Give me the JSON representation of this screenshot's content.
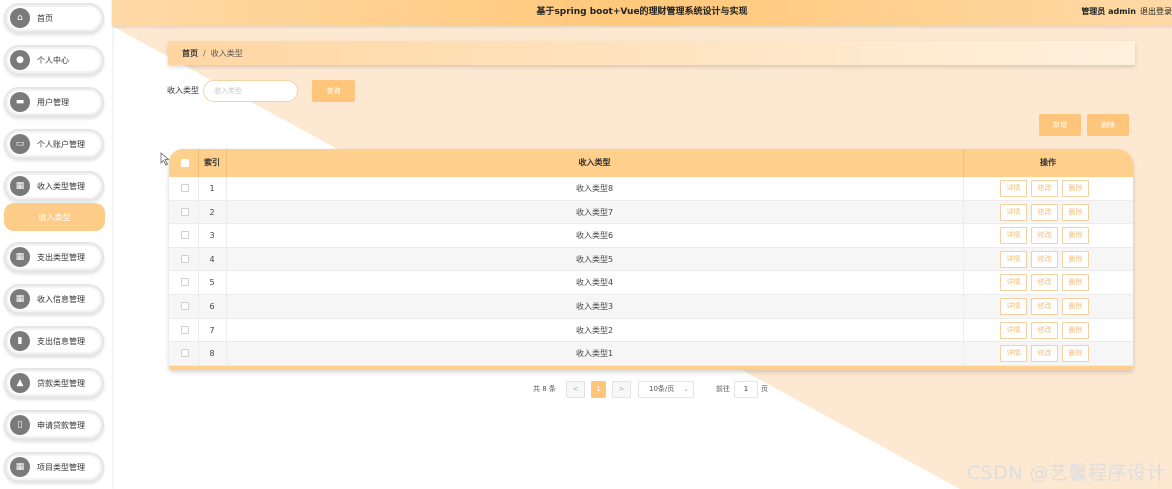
{
  "header": {
    "title": "基于spring boot+Vue的理财管理系统设计与实现",
    "user": "管理员 admin",
    "logout": "退出登录"
  },
  "sidebar": {
    "items": [
      {
        "label": "首页",
        "icon": "home-icon"
      },
      {
        "label": "个人中心",
        "icon": "user-icon"
      },
      {
        "label": "用户管理",
        "icon": "users-icon"
      },
      {
        "label": "个人账户管理",
        "icon": "wallet-icon"
      },
      {
        "label": "收入类型管理",
        "icon": "grid-icon"
      },
      {
        "label": "支出类型管理",
        "icon": "grid-icon"
      },
      {
        "label": "收入信息管理",
        "icon": "grid-icon"
      },
      {
        "label": "支出信息管理",
        "icon": "chart-icon"
      },
      {
        "label": "贷款类型管理",
        "icon": "car-icon"
      },
      {
        "label": "申请贷款管理",
        "icon": "doc-icon"
      },
      {
        "label": "项目类型管理",
        "icon": "grid-icon"
      }
    ],
    "active_sub": "收入类型"
  },
  "breadcrumb": {
    "home": "首页",
    "sep": "/",
    "current": "收入类型"
  },
  "search": {
    "label": "收入类型",
    "placeholder": "收入类型",
    "button": "查询"
  },
  "actions": {
    "add": "新增",
    "delete": "删除"
  },
  "table": {
    "headers": {
      "index": "索引",
      "type": "收入类型",
      "ops": "操作"
    },
    "op_labels": {
      "detail": "详情",
      "edit": "修改",
      "delete": "删除"
    },
    "rows": [
      {
        "index": "1",
        "type": "收入类型8"
      },
      {
        "index": "2",
        "type": "收入类型7"
      },
      {
        "index": "3",
        "type": "收入类型6"
      },
      {
        "index": "4",
        "type": "收入类型5"
      },
      {
        "index": "5",
        "type": "收入类型4"
      },
      {
        "index": "6",
        "type": "收入类型3"
      },
      {
        "index": "7",
        "type": "收入类型2"
      },
      {
        "index": "8",
        "type": "收入类型1"
      }
    ]
  },
  "pagination": {
    "total": "共 8 条",
    "prev": "<",
    "page": "1",
    "next": ">",
    "page_size": "10条/页",
    "goto_label": "前往",
    "goto_value": "1",
    "goto_suffix": "页"
  },
  "watermark": "CSDN @艺馨程序设计",
  "colors": {
    "accent": "#ffc57b",
    "header": "#ffcf8c",
    "background_wedge": "#fde8cf"
  }
}
